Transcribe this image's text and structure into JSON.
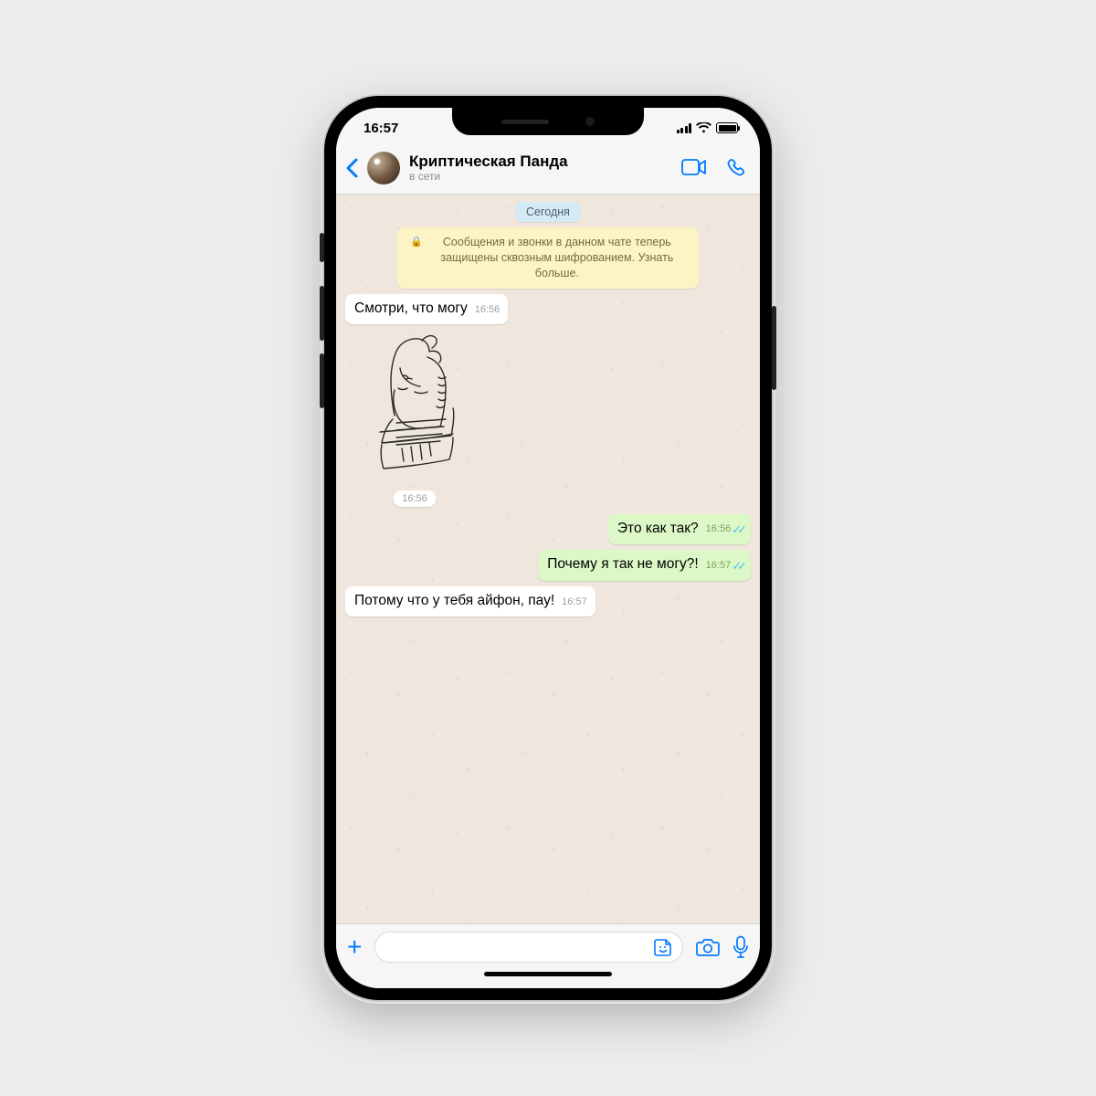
{
  "statusbar": {
    "time": "16:57"
  },
  "header": {
    "contact_name": "Криптическая Панда",
    "presence": "в сети"
  },
  "date_chip": "Сегодня",
  "encryption_notice": "Сообщения и звонки в данном чате теперь защищены сквозным шифрованием. Узнать больше.",
  "messages": [
    {
      "dir": "in",
      "text": "Смотри, что могу",
      "time": "16:56"
    },
    {
      "dir": "in",
      "kind": "sticker",
      "sticker": "egyptian-queen-profile",
      "time": "16:56"
    },
    {
      "dir": "out",
      "text": "Это как так?",
      "time": "16:56",
      "read": true
    },
    {
      "dir": "out",
      "text": "Почему я так не могу?!",
      "time": "16:57",
      "read": true
    },
    {
      "dir": "in",
      "text": "Потому что у тебя айфон, пау!",
      "time": "16:57"
    }
  ],
  "colors": {
    "accent": "#007AFF",
    "bubble_out": "#DCF8C6",
    "bubble_in": "#FFFFFF",
    "chat_bg": "#EFE7DD"
  }
}
